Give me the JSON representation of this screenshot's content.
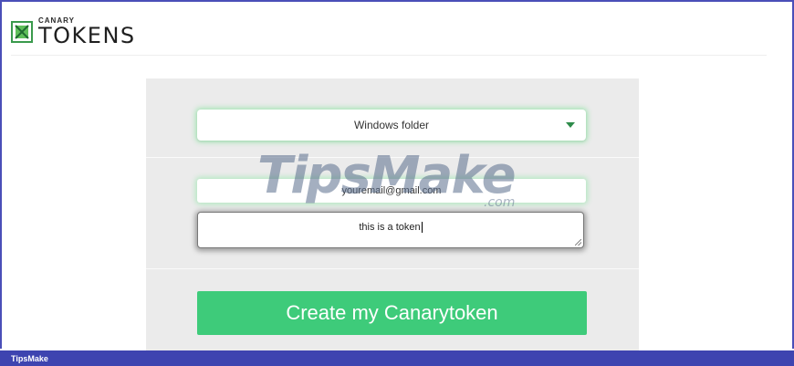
{
  "brand": {
    "small": "CANARY",
    "big": "TOKENS"
  },
  "form": {
    "token_type": "Windows folder",
    "email_value": "youremail@gmail.com",
    "memo_value": "this is a token",
    "create_label": "Create my Canarytoken"
  },
  "watermark": {
    "text": "TipsMake",
    "suffix": ".com"
  },
  "footer": {
    "label": "TipsMake"
  },
  "colors": {
    "accent": "#3ecb7a",
    "footer": "#3e44b0"
  }
}
